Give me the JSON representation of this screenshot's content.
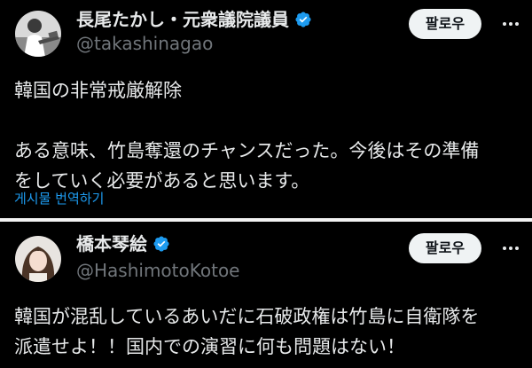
{
  "colors": {
    "background": "#000000",
    "text": "#e7e9ea",
    "secondary_text": "#71767b",
    "accent_blue": "#1d9bf0",
    "button_bg": "#eff3f4",
    "button_text": "#0f1419"
  },
  "posts": [
    {
      "display_name": "長尾たかし・元衆議院議員",
      "handle": "@takashinagao",
      "verified_icon": "verified-badge-icon",
      "follow_label": "팔로우",
      "more_icon": "more-options-icon",
      "body_lines": [
        "韓国の非常戒厳解除",
        "",
        "ある意味、竹島奪還のチャンスだった。今後はその準備",
        "をしていく必要があると思います。"
      ],
      "translate_label": "게시물 번역하기"
    },
    {
      "display_name": "橋本琴絵",
      "handle": "@HashimotoKotoe",
      "verified_icon": "verified-badge-icon",
      "follow_label": "팔로우",
      "more_icon": "more-options-icon",
      "body_lines": [
        "韓国が混乱しているあいだに石破政権は竹島に自衛隊を",
        "派遣せよ！！国内での演習に何も問題はない！"
      ]
    }
  ]
}
